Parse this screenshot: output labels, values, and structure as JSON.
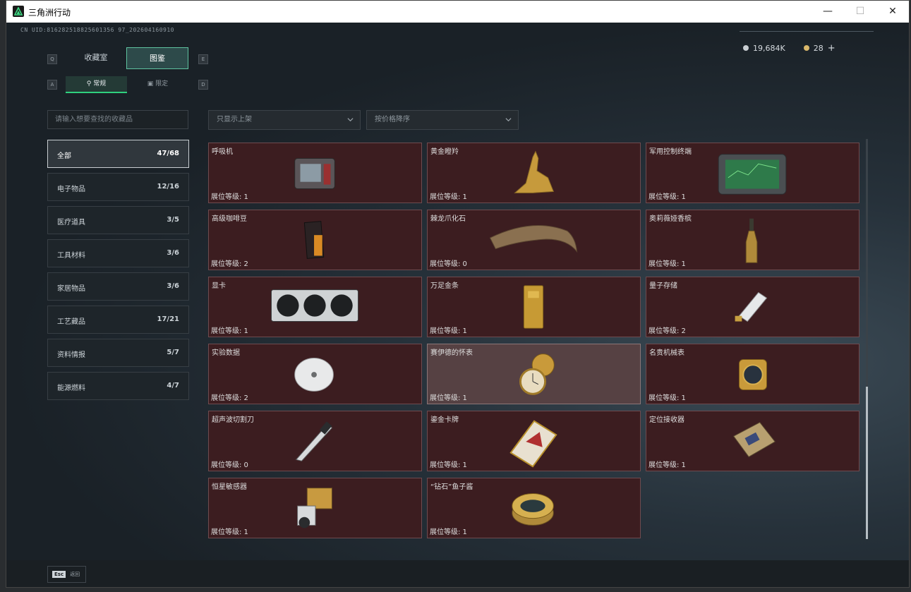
{
  "window": {
    "title": "三角洲行动",
    "minimize": "—",
    "maximize": "☐",
    "close": "✕"
  },
  "uid": "CN UID:816282518825601356 97_202604160910",
  "currency": {
    "coins": "19,684K",
    "gems": "28",
    "add": "+"
  },
  "key_hints": {
    "q": "Q",
    "e": "E",
    "a": "A",
    "d": "D"
  },
  "tabs": [
    {
      "label": "收藏室"
    },
    {
      "label": "图鉴"
    }
  ],
  "subtabs": [
    {
      "label": "常规"
    },
    {
      "label": "限定"
    }
  ],
  "search": {
    "placeholder": "请输入想要查找的收藏品"
  },
  "filters": {
    "shelf": "只显示上架",
    "sort": "按价格降序"
  },
  "categories": [
    {
      "name": "全部",
      "count": "47/68"
    },
    {
      "name": "电子物品",
      "count": "12/16"
    },
    {
      "name": "医疗道具",
      "count": "3/5"
    },
    {
      "name": "工具材料",
      "count": "3/6"
    },
    {
      "name": "家居物品",
      "count": "3/6"
    },
    {
      "name": "工艺藏品",
      "count": "17/21"
    },
    {
      "name": "资料情报",
      "count": "5/7"
    },
    {
      "name": "能源燃料",
      "count": "4/7"
    }
  ],
  "items": [
    {
      "name": "呼吸机",
      "level": "展位等级: 1",
      "icon": "ventilator-icon"
    },
    {
      "name": "黄金瞪羚",
      "level": "展位等级: 1",
      "icon": "golden-gazelle-icon"
    },
    {
      "name": "军用控制终端",
      "level": "展位等级: 1",
      "icon": "military-terminal-icon"
    },
    {
      "name": "高级咖啡豆",
      "level": "展位等级: 2",
      "icon": "coffee-bag-icon"
    },
    {
      "name": "棘龙爪化石",
      "level": "展位等级: 0",
      "icon": "claw-fossil-icon"
    },
    {
      "name": "奥莉薇娅香槟",
      "level": "展位等级: 1",
      "icon": "champagne-icon"
    },
    {
      "name": "显卡",
      "level": "展位等级: 1",
      "icon": "graphics-card-icon"
    },
    {
      "name": "万足金条",
      "level": "展位等级: 1",
      "icon": "gold-bar-icon"
    },
    {
      "name": "量子存储",
      "level": "展位等级: 2",
      "icon": "quantum-storage-icon"
    },
    {
      "name": "实验数据",
      "level": "展位等级: 2",
      "icon": "disc-icon"
    },
    {
      "name": "赛伊德的怀表",
      "level": "展位等级: 1",
      "icon": "pocket-watch-icon"
    },
    {
      "name": "名贵机械表",
      "level": "展位等级: 1",
      "icon": "wristwatch-icon"
    },
    {
      "name": "超声波切割刀",
      "level": "展位等级: 0",
      "icon": "ultrasonic-knife-icon"
    },
    {
      "name": "鎏金卡牌",
      "level": "展位等级: 1",
      "icon": "gilded-card-icon"
    },
    {
      "name": "定位接收器",
      "level": "展位等级: 1",
      "icon": "gps-receiver-icon"
    },
    {
      "name": "恒星敏感器",
      "level": "展位等级: 1",
      "icon": "star-sensor-icon"
    },
    {
      "name": "“钻石”鱼子酱",
      "level": "展位等级: 1",
      "icon": "caviar-tin-icon"
    }
  ],
  "footer": {
    "esc_key": "Esc",
    "esc_label": "返回"
  },
  "colors": {
    "accent": "#2fd07e",
    "card_bg": "#3c1d20",
    "card_border": "#6e4b4f"
  }
}
